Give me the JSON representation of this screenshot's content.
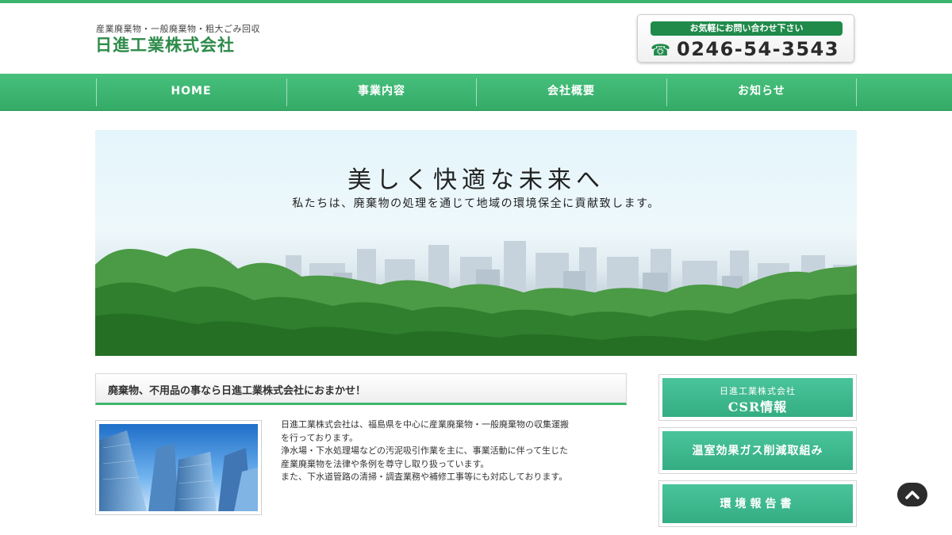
{
  "header": {
    "tagline": "産業廃棄物・一般廃棄物・粗大ごみ回収",
    "company_name": "日進工業株式会社",
    "contact_label": "お気軽にお問い合わせ下さい",
    "phone_icon": "☎",
    "phone_number": "0246-54-3543"
  },
  "nav": {
    "items": [
      {
        "label": "HOME"
      },
      {
        "label": "事業内容"
      },
      {
        "label": "会社概要"
      },
      {
        "label": "お知らせ"
      }
    ]
  },
  "hero": {
    "title": "美しく快適な未来へ",
    "subtitle": "私たちは、廃棄物の処理を通じて地域の環境保全に貢献致します。"
  },
  "main": {
    "heading": "廃棄物、不用品の事なら日進工業株式会社におまかせ！",
    "intro_lines": [
      "日進工業株式会社は、福島県を中心に産業廃棄物・一般廃棄物の収集運搬",
      "を行っております。",
      "浄水場・下水処理場などの汚泥吸引作業を主に、事業活動に伴って生じた",
      "産業廃棄物を法律や条例を尊守し取り扱っています。",
      "また、下水道管路の清掃・調査業務や補修工事等にも対応しております。"
    ]
  },
  "sidebar": {
    "csr_small": "日進工業株式会社",
    "csr_large": "CSR情報",
    "ghg": "温室効果ガス削減取組み",
    "env_report": "環境報告書"
  },
  "colors": {
    "brand_green": "#3db46d",
    "banner_teal": "#3bb38a",
    "dark_green": "#1f8a4a"
  },
  "icons": {
    "phone": "phone-icon",
    "scroll_top": "chevron-up-icon"
  }
}
